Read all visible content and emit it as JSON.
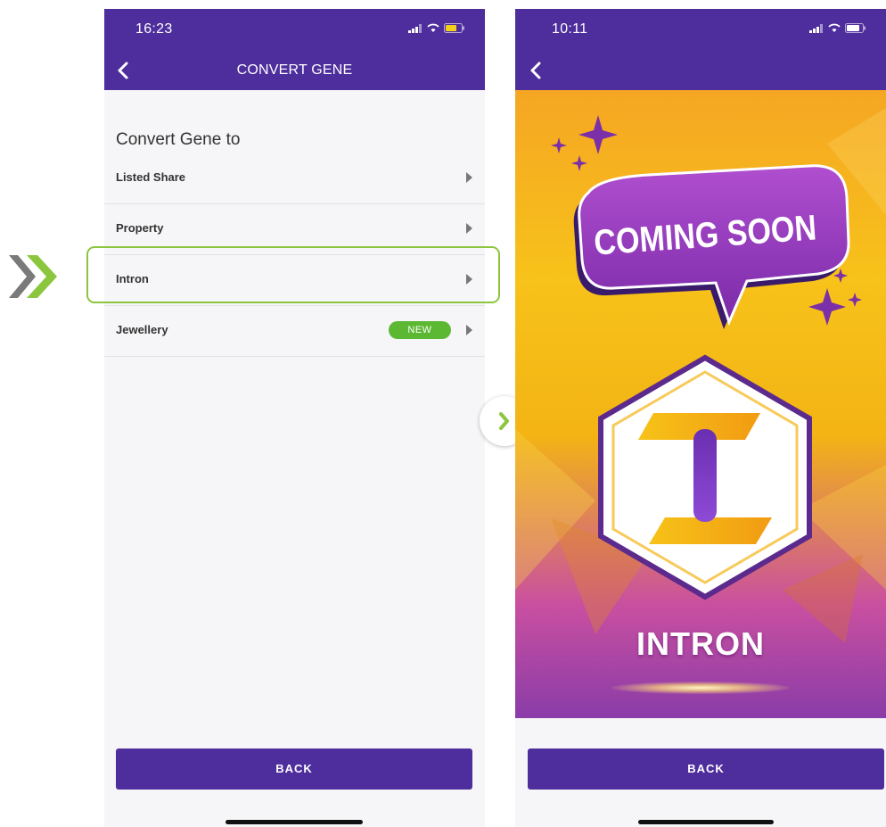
{
  "colors": {
    "brand_purple": "#4e2d9c",
    "accent_green": "#8cc63f",
    "new_badge": "#5cb833"
  },
  "left_screen": {
    "time": "16:23",
    "title": "CONVERT GENE",
    "heading": "Convert Gene to",
    "items": [
      {
        "label": "Listed Share"
      },
      {
        "label": "Property"
      },
      {
        "label": "Intron"
      },
      {
        "label": "Jewellery",
        "badge": "NEW"
      }
    ],
    "back_button": "BACK"
  },
  "right_screen": {
    "time": "10:11",
    "banner_text": "COMING SOON",
    "caption": "INTRON",
    "back_button": "BACK"
  },
  "icons": {
    "transition": "double-chevron-right-icon",
    "next": "chevron-right-icon",
    "back": "chevron-left-icon",
    "row": "triangle-right-icon"
  }
}
